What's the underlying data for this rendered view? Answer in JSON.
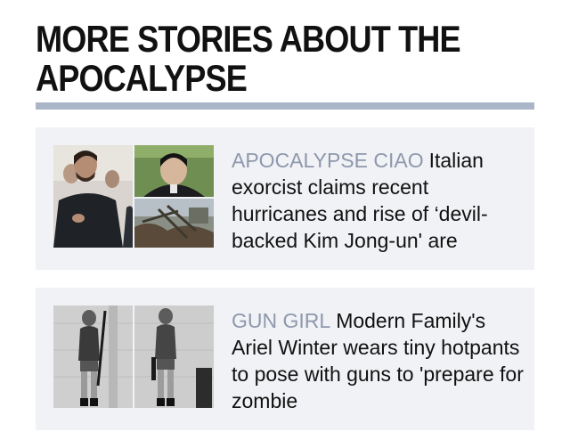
{
  "section": {
    "title": "MORE STORIES ABOUT THE APOCALYPSE"
  },
  "stories": [
    {
      "kicker": "APOCALYPSE CIAO",
      "headline": "Italian exorcist claims recent hurricanes and rise of ‘devil-backed Kim Jong-un' are"
    },
    {
      "kicker": "GUN GIRL",
      "headline": "Modern Family's Ariel Winter wears tiny hotpants to pose with guns to 'prepare for zombie"
    }
  ],
  "colors": {
    "accent_rule": "#aab5c8",
    "kicker": "#8e98ad",
    "card_bg": "#f1f2f5"
  }
}
